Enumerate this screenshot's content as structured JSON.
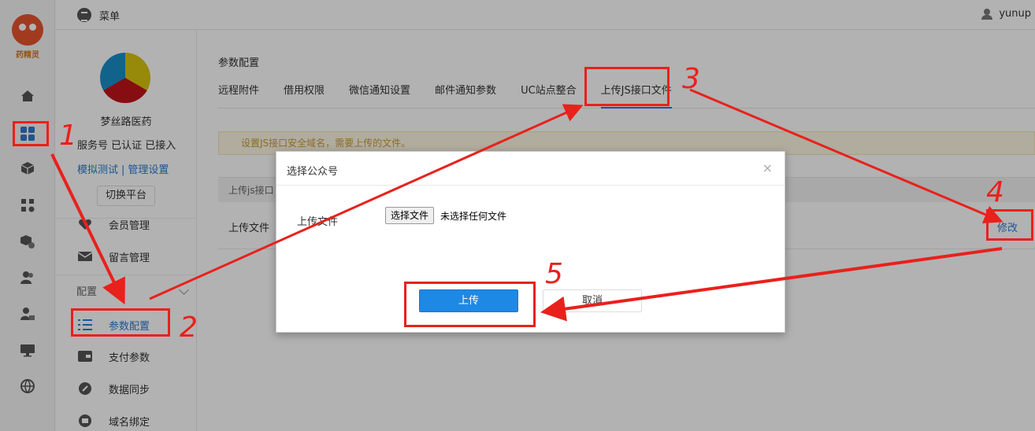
{
  "brand": {
    "logo_text": "药精灵"
  },
  "header": {
    "menu_label": "菜单",
    "username": "yunup"
  },
  "account": {
    "name": "梦丝路医药",
    "status": "服务号 已认证 已接入",
    "link_test": "模拟测试",
    "link_separator": "|",
    "link_manage": "管理设置",
    "switch_label": "切换平台"
  },
  "sidebar": {
    "items_top": [
      {
        "label": "会员管理",
        "icon": "heart-icon"
      },
      {
        "label": "留言管理",
        "icon": "mail-icon"
      }
    ],
    "section_label": "配置",
    "items_config": [
      {
        "label": "参数配置",
        "icon": "list-icon",
        "active": true
      },
      {
        "label": "支付参数",
        "icon": "wallet-icon"
      },
      {
        "label": "数据同步",
        "icon": "link-icon"
      },
      {
        "label": "域名绑定",
        "icon": "domain-icon"
      }
    ]
  },
  "rail_icons": [
    "home-icon",
    "apps-icon",
    "cube-icon",
    "widgets-icon",
    "box-gear-icon",
    "users-icon",
    "user-lock-icon",
    "monitor-icon",
    "globe-icon"
  ],
  "main": {
    "page_title": "参数配置",
    "tabs": [
      "远程附件",
      "借用权限",
      "微信通知设置",
      "邮件通知参数",
      "UC站点整合",
      "上传JS接口文件"
    ],
    "notice": "设置JS接口安全域名，需要上传的文件。",
    "table_head": "上传js接口",
    "row_label": "上传文件",
    "row_action": "修改"
  },
  "modal": {
    "title": "选择公众号",
    "close": "×",
    "field_label": "上传文件",
    "file_button": "选择文件",
    "file_status": "未选择任何文件",
    "submit": "上传",
    "cancel": "取消"
  },
  "annotations": [
    "1",
    "2",
    "3",
    "4",
    "5"
  ],
  "colors": {
    "accent": "#2a7ad2",
    "primary_button": "#1e88e5",
    "annotation": "#e8211c",
    "notice_text": "#c89a3e"
  }
}
